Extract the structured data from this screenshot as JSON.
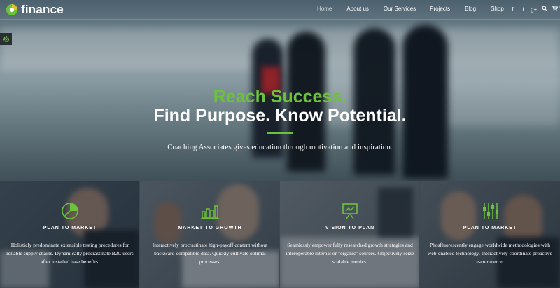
{
  "brand": {
    "name": "finance",
    "accent": "#6cc23a"
  },
  "nav": {
    "items": [
      {
        "label": "Home"
      },
      {
        "label": "About us"
      },
      {
        "label": "Our Services"
      },
      {
        "label": "Projects"
      },
      {
        "label": "Blog"
      },
      {
        "label": "Shop"
      }
    ]
  },
  "social": {
    "facebook": "f",
    "twitter": "t",
    "google": "g+",
    "search_icon": "search-icon",
    "cart_icon": "cart-icon"
  },
  "hero": {
    "title_line1": "Reach Success.",
    "title_line2": "Find Purpose. Know Potential.",
    "subtitle": "Coaching Associates gives education through motivation and inspiration."
  },
  "cards": [
    {
      "title": "PLAN TO MARKET",
      "icon": "pie-chart-icon",
      "text": "Holisticly predominate extensible testing procedures for reliable supply chains. Dynamically procrastinate B2C users after installed base benefits."
    },
    {
      "title": "MARKET TO GROWTH",
      "icon": "bar-chart-icon",
      "text": "Interactively procrastinate high-payoff content without backward-compatible data. Quickly cultivate optimal processes."
    },
    {
      "title": "VISION TO PLAN",
      "icon": "presentation-board-icon",
      "text": "Seamlessly empower fully researched growth strategies and interoperable internal or \"organic\" sources. Objectively seize scalable metrics."
    },
    {
      "title": "PLAN TO MARKET",
      "icon": "equalizer-icon",
      "text": "Phosfluorescently engage worldwide methodologies with web-enabled technology. Interactively coordinate proactive e-commerce."
    }
  ]
}
